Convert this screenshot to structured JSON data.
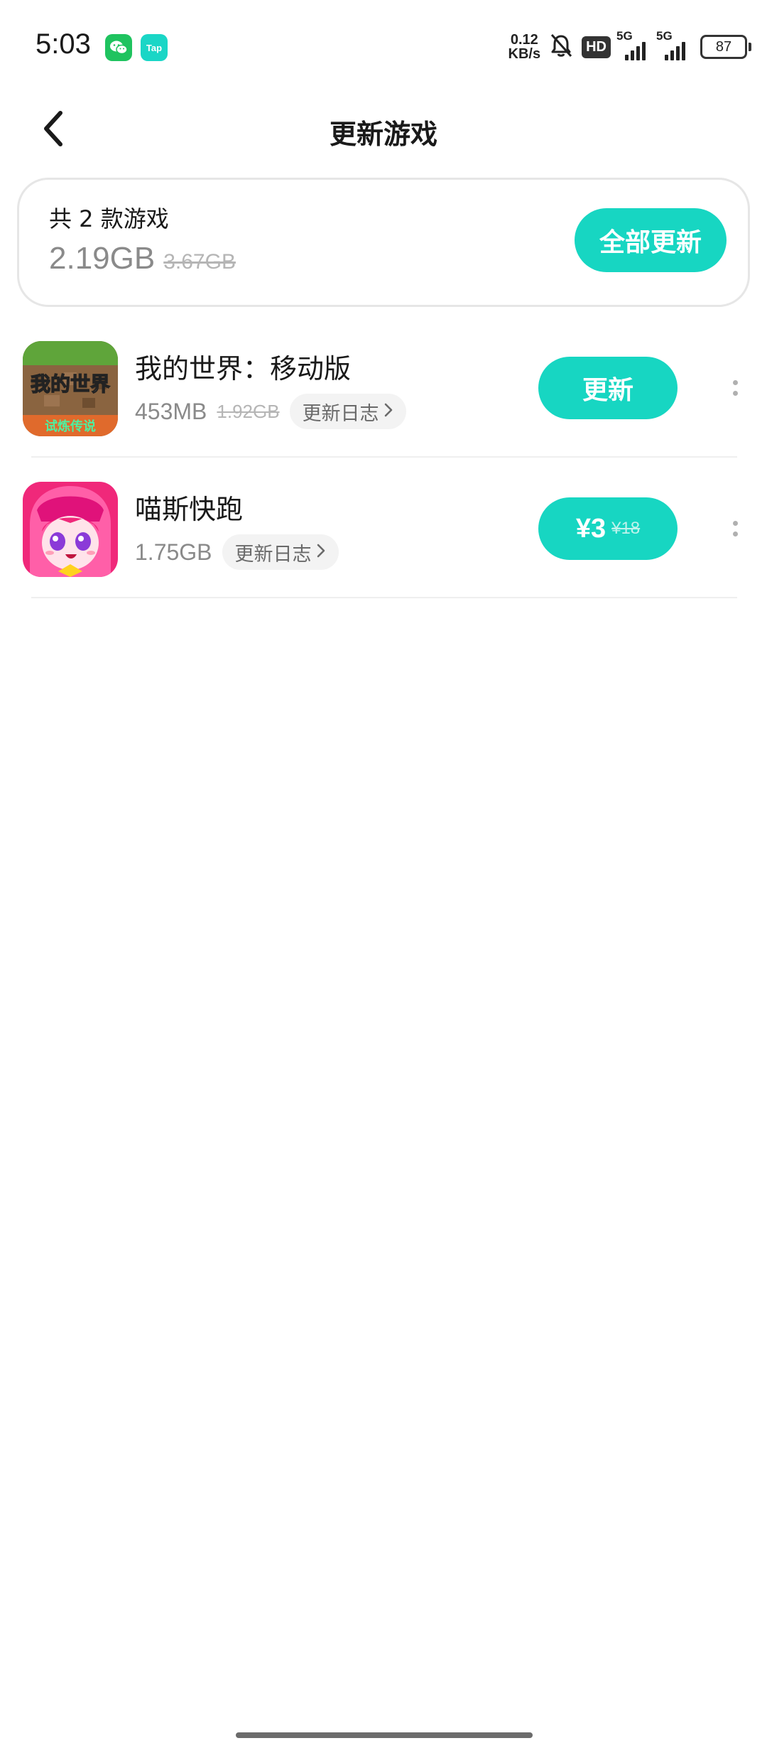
{
  "status_bar": {
    "time": "5:03",
    "net_speed_value": "0.12",
    "net_speed_unit": "KB/s",
    "hd_label": "HD",
    "signal_1_label": "5G",
    "signal_2_label": "5G",
    "battery_level": "87",
    "tap_badge_label": "Tap",
    "icons": [
      "wechat-icon",
      "taptap-icon",
      "bell-muted-icon",
      "signal-icon",
      "battery-icon"
    ]
  },
  "header": {
    "title": "更新游戏",
    "back_icon": "chevron-left-icon"
  },
  "summary": {
    "count_text": "共 2 款游戏",
    "total_size": "2.19GB",
    "original_size": "3.67GB",
    "update_all_label": "全部更新"
  },
  "games": [
    {
      "name": "我的世界：移动版",
      "size": "453MB",
      "original_size": "1.92GB",
      "changelog_label": "更新日志",
      "action_label": "更新",
      "icon_text_top": "我的世界",
      "icon_text_bottom": "试炼传说"
    },
    {
      "name": "喵斯快跑",
      "size": "1.75GB",
      "changelog_label": "更新日志",
      "price_current": "¥3",
      "price_original": "¥18"
    }
  ],
  "colors": {
    "accent": "#17d6c2",
    "text_primary": "#1a1a1a",
    "text_secondary": "#8a8a8a",
    "text_strike": "#b5b5b5",
    "chip_bg": "#f3f3f3"
  }
}
